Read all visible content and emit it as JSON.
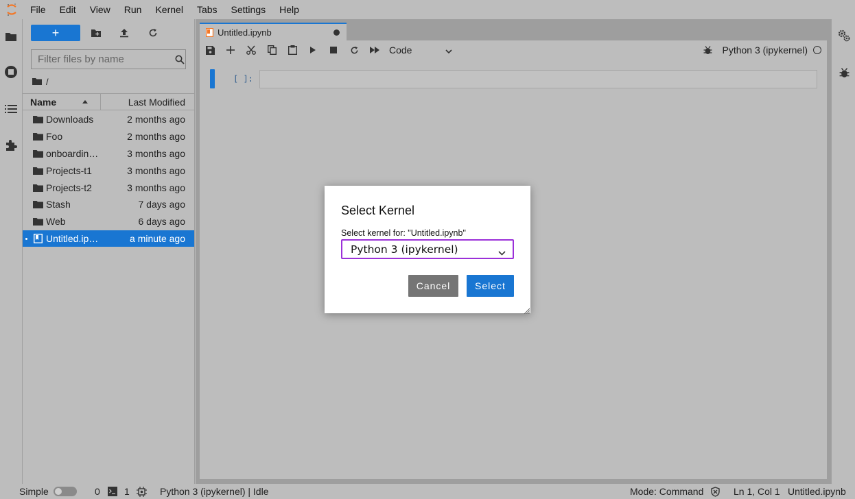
{
  "menubar": {
    "items": [
      "File",
      "Edit",
      "View",
      "Run",
      "Kernel",
      "Tabs",
      "Settings",
      "Help"
    ]
  },
  "filebrowser": {
    "new_label": "+",
    "filter_placeholder": "Filter files by name",
    "breadcrumb": "/",
    "columns": {
      "name": "Name",
      "modified": "Last Modified"
    },
    "files": [
      {
        "name": "Downloads",
        "modified": "2 months ago",
        "type": "folder"
      },
      {
        "name": "Foo",
        "modified": "2 months ago",
        "type": "folder"
      },
      {
        "name": "onboardin…",
        "modified": "3 months ago",
        "type": "folder"
      },
      {
        "name": "Projects-t1",
        "modified": "3 months ago",
        "type": "folder"
      },
      {
        "name": "Projects-t2",
        "modified": "3 months ago",
        "type": "folder"
      },
      {
        "name": "Stash",
        "modified": "7 days ago",
        "type": "folder"
      },
      {
        "name": "Web",
        "modified": "6 days ago",
        "type": "folder"
      },
      {
        "name": "Untitled.ip…",
        "modified": "a minute ago",
        "type": "notebook",
        "selected": true
      }
    ]
  },
  "tab": {
    "title": "Untitled.ipynb"
  },
  "notebook": {
    "cell_type": "Code",
    "kernel_name": "Python 3 (ipykernel)",
    "cell_prompt": "[ ]:"
  },
  "dialog": {
    "title": "Select Kernel",
    "label": "Select kernel for: \"Untitled.ipynb\"",
    "selected_kernel": "Python 3 (ipykernel)",
    "cancel_label": "Cancel",
    "select_label": "Select"
  },
  "statusbar": {
    "mode_label": "Simple",
    "terminals_count": "0",
    "kernels_count": "1",
    "kernel_status": "Python 3 (ipykernel) | Idle",
    "mode": "Mode: Command",
    "cursor": "Ln 1, Col 1",
    "file": "Untitled.ipynb"
  },
  "colors": {
    "accent": "#1976d2",
    "dialog_focus": "#9b30d9",
    "logo": "#f37726"
  }
}
